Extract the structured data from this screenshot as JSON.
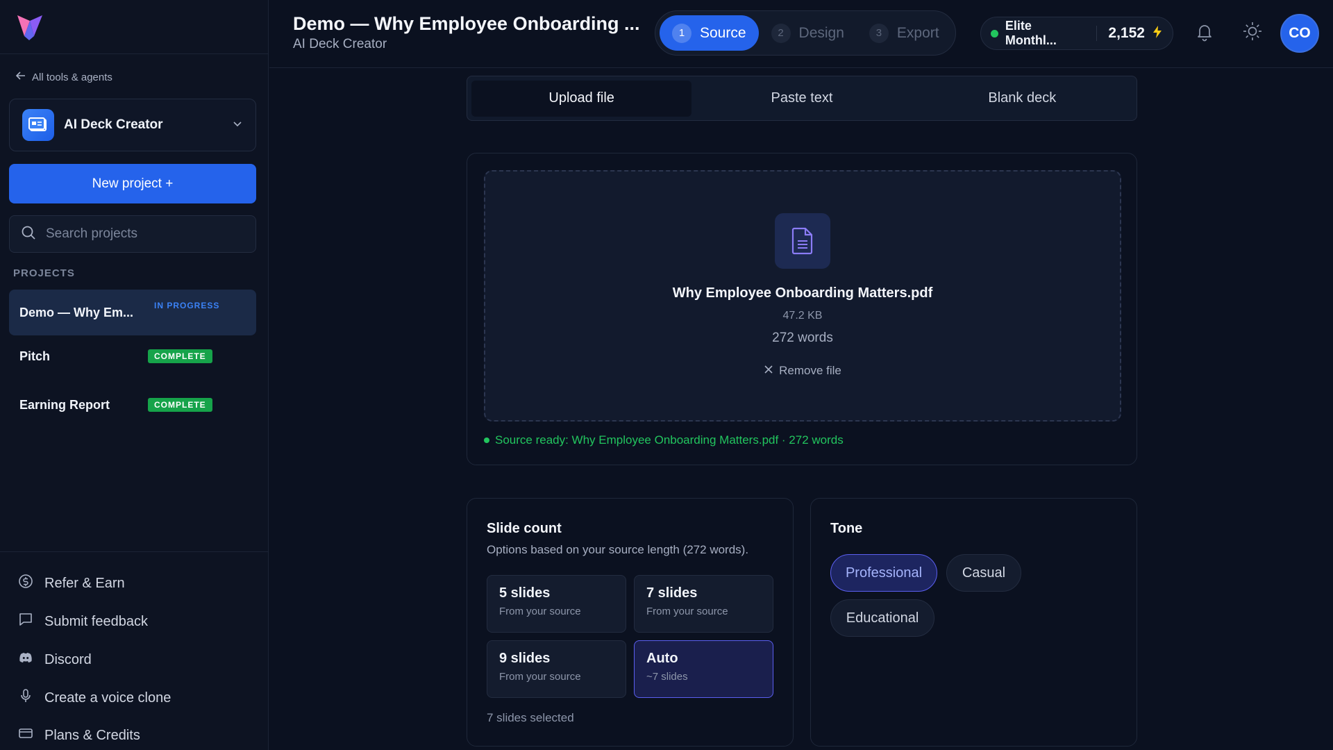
{
  "sidebar": {
    "back_label": "All tools & agents",
    "tool_name": "AI Deck Creator",
    "new_project_label": "New project +",
    "search_placeholder": "Search projects",
    "projects_heading": "PROJECTS",
    "projects": [
      {
        "name": "Demo — Why Em...",
        "status": "IN PROGRESS"
      },
      {
        "name": "Pitch",
        "status": "COMPLETE"
      },
      {
        "name": "Earning Report",
        "status": "COMPLETE"
      }
    ],
    "links": [
      {
        "label": "Refer & Earn",
        "icon": "dollar-icon"
      },
      {
        "label": "Submit feedback",
        "icon": "message-square-icon"
      },
      {
        "label": "Discord",
        "icon": "discord-icon"
      },
      {
        "label": "Create a voice clone",
        "icon": "microphone-icon"
      },
      {
        "label": "Plans & Credits",
        "icon": "credit-card-icon"
      }
    ]
  },
  "header": {
    "title": "Demo — Why Employee Onboarding ...",
    "subtitle": "AI Deck Creator",
    "steps": [
      {
        "num": "1",
        "label": "Source"
      },
      {
        "num": "2",
        "label": "Design"
      },
      {
        "num": "3",
        "label": "Export"
      }
    ],
    "plan": "Elite Monthl...",
    "credits": "2,152",
    "avatar_initials": "CO"
  },
  "main": {
    "tabs": [
      "Upload file",
      "Paste text",
      "Blank deck"
    ],
    "file": {
      "name": "Why Employee Onboarding Matters.pdf",
      "size": "47.2 KB",
      "words": "272 words",
      "remove_label": "Remove file"
    },
    "source_ready": "Source ready: Why Employee Onboarding Matters.pdf · 272 words",
    "slide_count": {
      "title": "Slide count",
      "subtitle": "Options based on your source length (272 words).",
      "options": [
        {
          "title": "5 slides",
          "sub": "From your source"
        },
        {
          "title": "7 slides",
          "sub": "From your source"
        },
        {
          "title": "9 slides",
          "sub": "From your source"
        },
        {
          "title": "Auto",
          "sub": "~7 slides"
        }
      ],
      "selected_text": "7 slides selected"
    },
    "tone": {
      "title": "Tone",
      "options": [
        "Professional",
        "Casual",
        "Educational"
      ]
    }
  },
  "colors": {
    "accent": "#2563eb",
    "background": "#0b1120",
    "success": "#22c55e",
    "selected_border": "#5b5ff0"
  }
}
